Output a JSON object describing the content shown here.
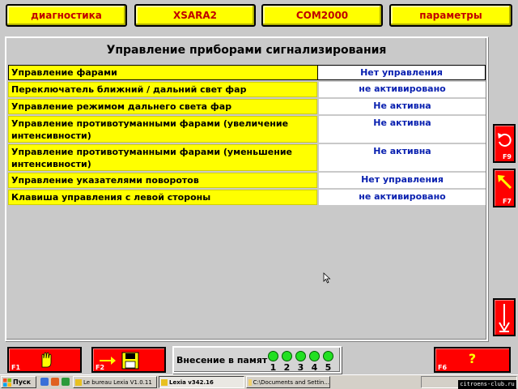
{
  "top_tabs": [
    {
      "label": "диагностика"
    },
    {
      "label": "XSARA2"
    },
    {
      "label": "COM2000"
    },
    {
      "label": "параметры"
    }
  ],
  "panel": {
    "title": "Управление приборами сигнализирования",
    "rows": [
      {
        "label": "Управление фарами",
        "value": "Нет управления",
        "selected": true
      },
      {
        "label": "Переключатель ближний / дальний свет фар",
        "value": "не активировано"
      },
      {
        "label": "Управление режимом дальнего света фар",
        "value": "Не активна"
      },
      {
        "label": "Управление противотуманными фарами (увеличение интенсивности)",
        "value": "Не активна"
      },
      {
        "label": "Управление противотуманными фарами (уменьшение интенсивности)",
        "value": "Не активна"
      },
      {
        "label": "Управление указателями поворотов",
        "value": "Нет управления"
      },
      {
        "label": "Клавиша управления с левой стороны",
        "value": "не активировано"
      }
    ]
  },
  "side_buttons": {
    "f9": {
      "key": "F9",
      "icon": "undo-arrow-icon"
    },
    "f7": {
      "key": "F7",
      "icon": "diagonal-arrow-icon"
    },
    "down": {
      "icon": "down-arrow-icon"
    }
  },
  "bottom": {
    "f1": {
      "key": "F1",
      "icon": "hand-stop-icon"
    },
    "f2": {
      "key": "F2",
      "icon": "save-arrow-icon"
    },
    "memo_label": "Внесение в памят",
    "memo_slots": [
      "1",
      "2",
      "3",
      "4",
      "5"
    ],
    "f6": {
      "key": "F6",
      "label": "?"
    }
  },
  "taskbar": {
    "start_label": "Пуск",
    "tasks": [
      {
        "label": "Le bureau Lexia V1.0.11",
        "active": false
      },
      {
        "label": "Lexia v342.16",
        "active": true
      },
      {
        "label": "C:\\Documents and Settin...",
        "active": false
      }
    ]
  },
  "watermark": "citroens-club.ru",
  "colors": {
    "accent_yellow": "#ffff00",
    "button_red": "#ff0000",
    "value_blue": "#0a21b0",
    "tab_text": "#c00000"
  }
}
